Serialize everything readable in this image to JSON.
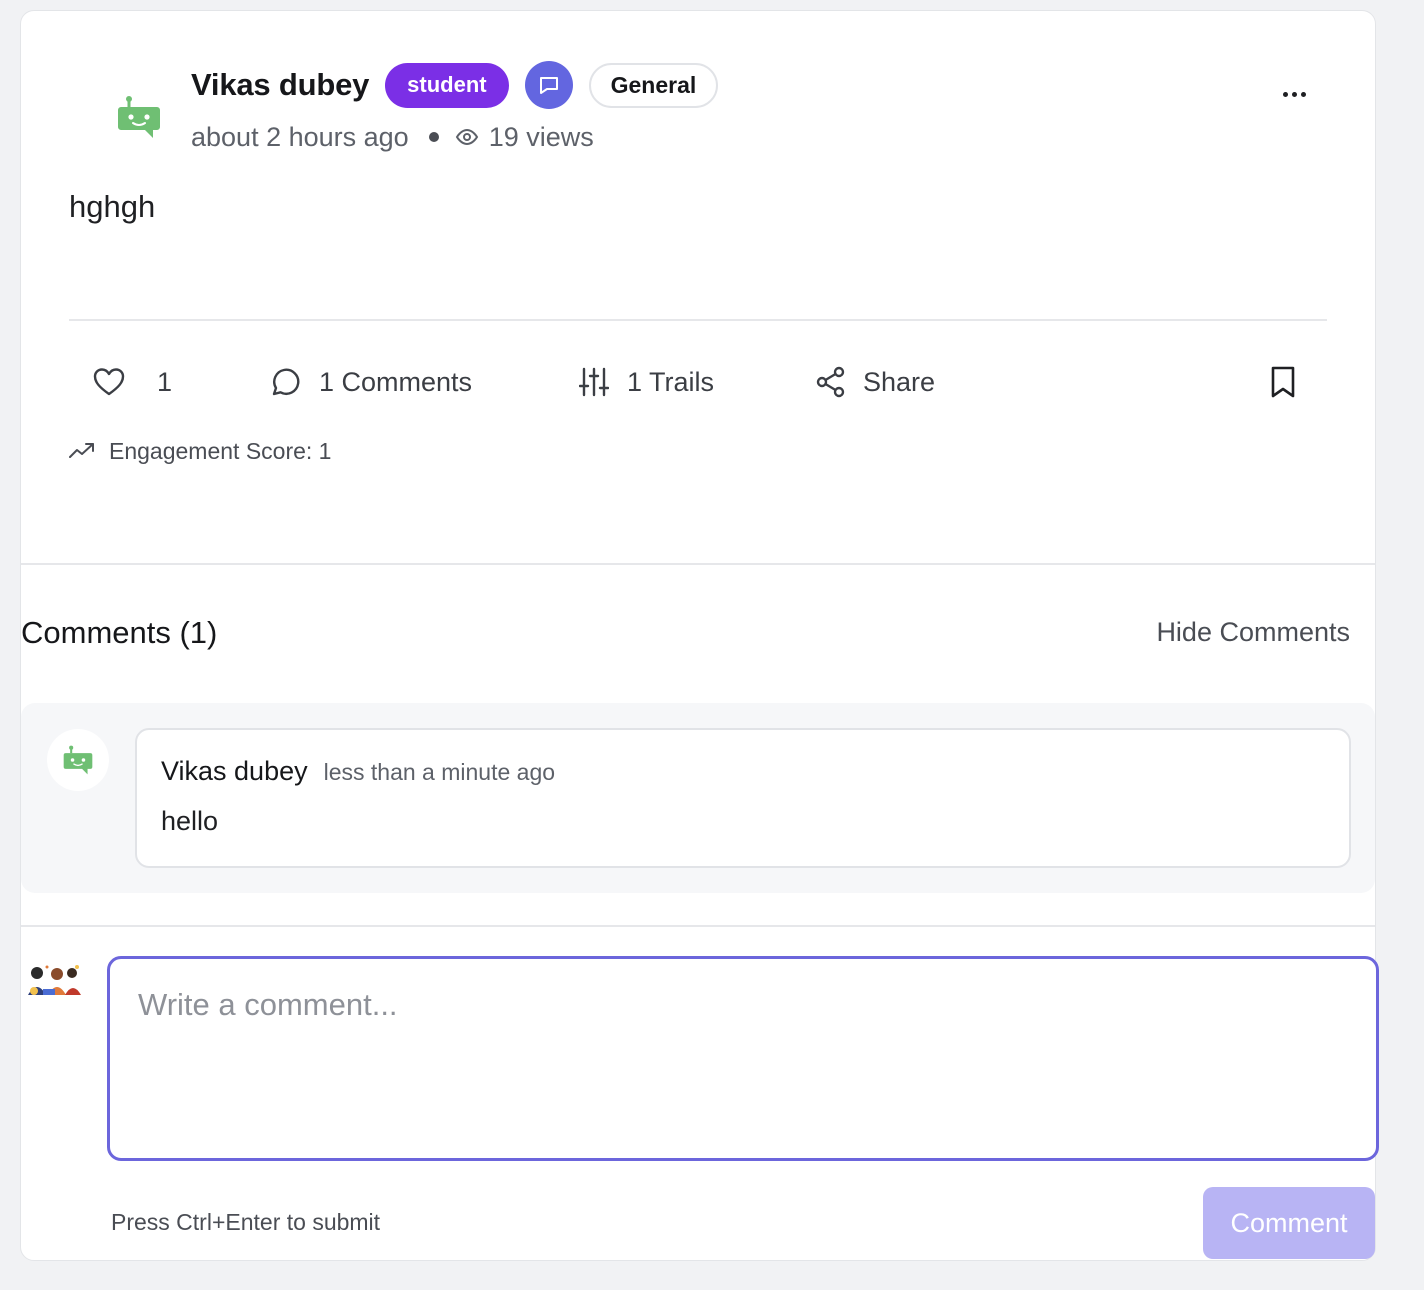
{
  "post": {
    "author": "Vikas dubey",
    "role_badge": "student",
    "category_badge": "General",
    "time_ago": "about 2 hours ago",
    "views": "19 views",
    "body": "hghgh",
    "more_icon": "more-horizontal-icon"
  },
  "actions": {
    "likes": "1",
    "comments": "1 Comments",
    "trails": "1 Trails",
    "share": "Share",
    "engagement": "Engagement Score: 1"
  },
  "comments_section": {
    "heading": "Comments (1)",
    "toggle_label": "Hide Comments",
    "items": [
      {
        "author": "Vikas dubey",
        "time": "less than a minute ago",
        "text": "hello"
      }
    ]
  },
  "composer": {
    "placeholder": "Write a comment...",
    "value": "",
    "hint": "Press Ctrl+Enter to submit",
    "submit_label": "Comment"
  },
  "colors": {
    "accent": "#6c66dc",
    "student_badge": "#7b2fe6",
    "chat_badge": "#6366e0",
    "bot_avatar": "#6fbf73",
    "submit_disabled": "#b8b4f4"
  }
}
